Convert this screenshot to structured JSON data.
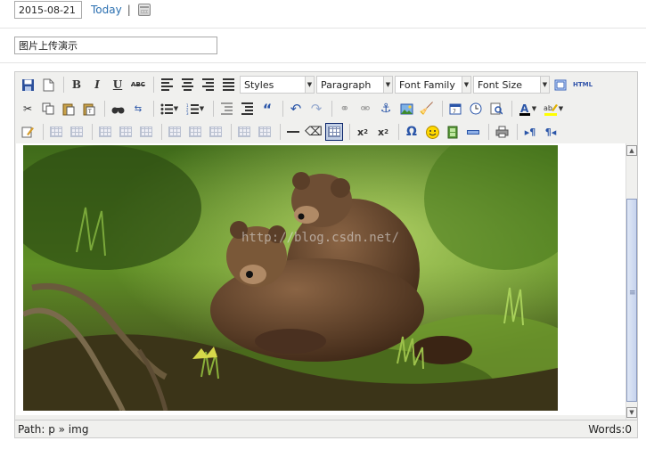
{
  "date": {
    "value": "2015-08-21",
    "today_label": "Today",
    "separator": "|"
  },
  "post_title": {
    "value": "图片上传演示"
  },
  "toolbar": {
    "styles": "Styles",
    "format": "Paragraph",
    "font_family": "Font Family",
    "font_size": "Font Size",
    "html_label": "HTML",
    "bold": "B",
    "italic": "I",
    "underline": "U",
    "strike": "ABC",
    "omega": "Ω"
  },
  "content": {
    "watermark": "http://blog.csdn.net/"
  },
  "statusbar": {
    "path": "Path: p » img",
    "words": "Words:0"
  },
  "colors": {
    "accent": "#2a6fb0",
    "toolbar_bg": "#f0f0ee"
  }
}
